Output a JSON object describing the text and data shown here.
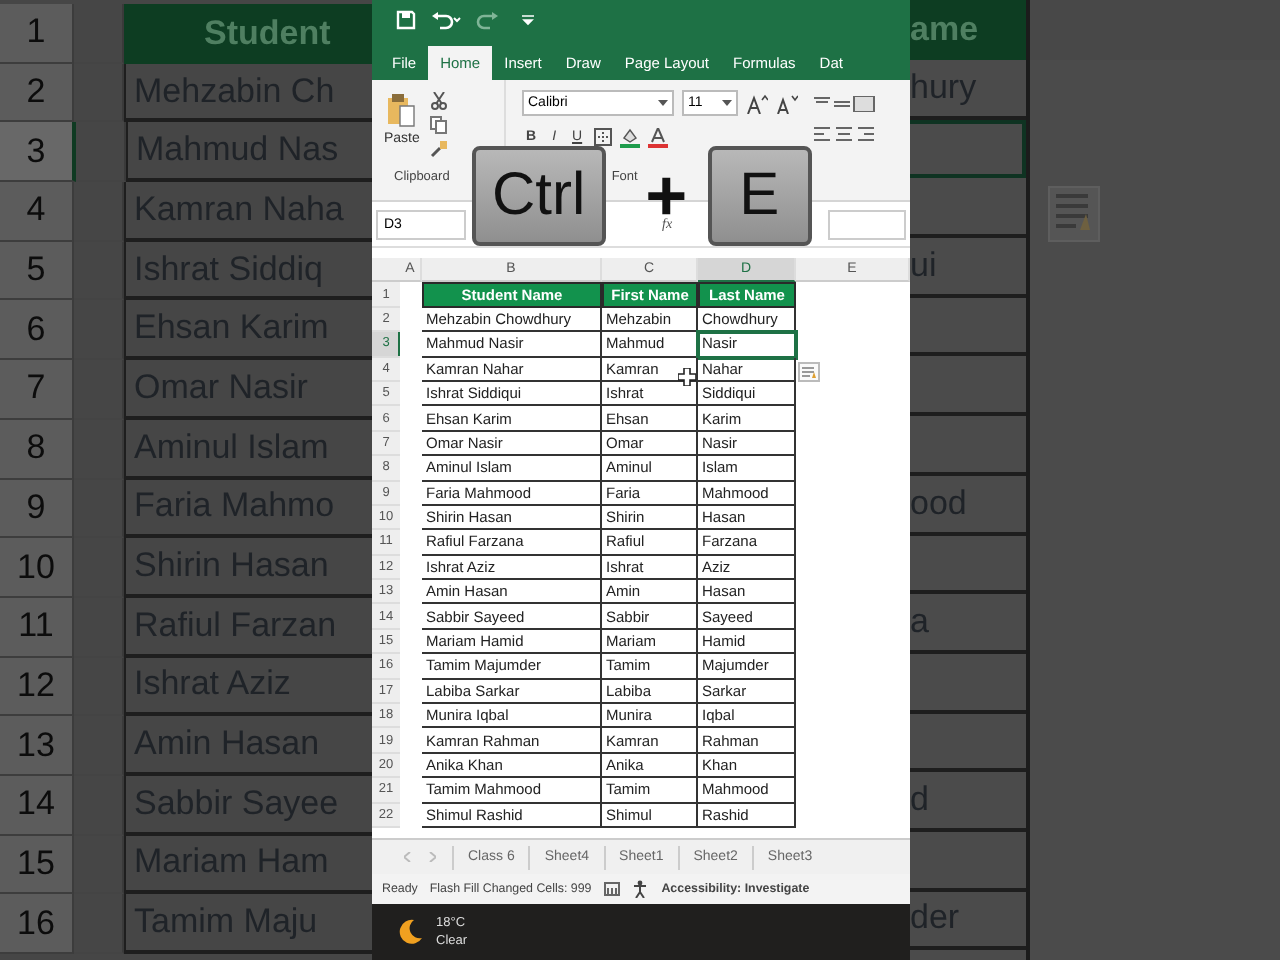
{
  "backdrop_left": {
    "header": {
      "number": "1",
      "text": "Student"
    },
    "rows": [
      {
        "number": "2",
        "text": "Mehzabin Ch",
        "selected": false
      },
      {
        "number": "3",
        "text": "Mahmud Nas",
        "selected": true
      },
      {
        "number": "4",
        "text": "Kamran Naha",
        "selected": false
      },
      {
        "number": "5",
        "text": "Ishrat Siddiq",
        "selected": false
      },
      {
        "number": "6",
        "text": "Ehsan Karim",
        "selected": false
      },
      {
        "number": "7",
        "text": "Omar Nasir",
        "selected": false
      },
      {
        "number": "8",
        "text": "Aminul Islam",
        "selected": false
      },
      {
        "number": "9",
        "text": "Faria Mahmo",
        "selected": false
      },
      {
        "number": "10",
        "text": "Shirin Hasan",
        "selected": false
      },
      {
        "number": "11",
        "text": "Rafiul Farzan",
        "selected": false
      },
      {
        "number": "12",
        "text": "Ishrat Aziz",
        "selected": false
      },
      {
        "number": "13",
        "text": "Amin Hasan",
        "selected": false
      },
      {
        "number": "14",
        "text": "Sabbir Sayee",
        "selected": false
      },
      {
        "number": "15",
        "text": "Mariam Ham",
        "selected": false
      },
      {
        "number": "16",
        "text": "Tamim Maju",
        "selected": false
      }
    ]
  },
  "ribbon_tabs": [
    {
      "label": "File",
      "selected": false
    },
    {
      "label": "Home",
      "selected": true
    },
    {
      "label": "Insert",
      "selected": false
    },
    {
      "label": "Draw",
      "selected": false
    },
    {
      "label": "Page Layout",
      "selected": false
    },
    {
      "label": "Formulas",
      "selected": false
    },
    {
      "label": "Dat",
      "selected": false
    }
  ],
  "ribbon": {
    "paste_label": "Paste",
    "font_name": "Calibri",
    "font_size": "11",
    "font_buttons": [
      "B",
      "I",
      "U"
    ],
    "groups": [
      "Clipboard",
      "Font"
    ]
  },
  "shortcut_overlay": {
    "keys": [
      "Ctrl",
      "E"
    ],
    "separator": "+"
  },
  "formula_bar": {
    "name_box": "D3",
    "function_label": "fx"
  },
  "columns": [
    {
      "label": "A",
      "selected": false
    },
    {
      "label": "B",
      "selected": false
    },
    {
      "label": "C",
      "selected": false
    },
    {
      "label": "D",
      "selected": true
    },
    {
      "label": "E",
      "selected": false
    }
  ],
  "table": {
    "header": {
      "number": "1",
      "cells": [
        "Student Name",
        "First Name",
        "Last Name"
      ]
    },
    "rows": [
      {
        "number": "2",
        "student": "Mehzabin Chowdhury",
        "first": "Mehzabin",
        "last": "Chowdhury",
        "selected": false
      },
      {
        "number": "3",
        "student": "Mahmud Nasir",
        "first": "Mahmud",
        "last": "Nasir",
        "selected": true
      },
      {
        "number": "4",
        "student": "Kamran Nahar",
        "first": "Kamran",
        "last": "Nahar",
        "selected": false
      },
      {
        "number": "5",
        "student": "Ishrat Siddiqui",
        "first": "Ishrat",
        "last": "Siddiqui",
        "selected": false
      },
      {
        "number": "6",
        "student": "Ehsan Karim",
        "first": "Ehsan",
        "last": "Karim",
        "selected": false
      },
      {
        "number": "7",
        "student": "Omar Nasir",
        "first": "Omar",
        "last": "Nasir",
        "selected": false
      },
      {
        "number": "8",
        "student": "Aminul Islam",
        "first": "Aminul",
        "last": "Islam",
        "selected": false
      },
      {
        "number": "9",
        "student": "Faria Mahmood",
        "first": "Faria",
        "last": "Mahmood",
        "selected": false
      },
      {
        "number": "10",
        "student": "Shirin Hasan",
        "first": "Shirin",
        "last": "Hasan",
        "selected": false
      },
      {
        "number": "11",
        "student": "Rafiul Farzana",
        "first": "Rafiul",
        "last": "Farzana",
        "selected": false
      },
      {
        "number": "12",
        "student": "Ishrat Aziz",
        "first": "Ishrat",
        "last": "Aziz",
        "selected": false
      },
      {
        "number": "13",
        "student": "Amin Hasan",
        "first": "Amin",
        "last": "Hasan",
        "selected": false
      },
      {
        "number": "14",
        "student": "Sabbir Sayeed",
        "first": "Sabbir",
        "last": "Sayeed",
        "selected": false
      },
      {
        "number": "15",
        "student": "Mariam Hamid",
        "first": "Mariam",
        "last": "Hamid",
        "selected": false
      },
      {
        "number": "16",
        "student": "Tamim Majumder",
        "first": "Tamim",
        "last": "Majumder",
        "selected": false
      },
      {
        "number": "17",
        "student": "Labiba Sarkar",
        "first": "Labiba",
        "last": "Sarkar",
        "selected": false
      },
      {
        "number": "18",
        "student": "Munira Iqbal",
        "first": "Munira",
        "last": "Iqbal",
        "selected": false
      },
      {
        "number": "19",
        "student": "Kamran Rahman",
        "first": "Kamran",
        "last": "Rahman",
        "selected": false
      },
      {
        "number": "20",
        "student": "Anika Khan",
        "first": "Anika",
        "last": "Khan",
        "selected": false
      },
      {
        "number": "21",
        "student": "Tamim Mahmood",
        "first": "Tamim",
        "last": "Mahmood",
        "selected": false
      },
      {
        "number": "22",
        "student": "Shimul Rashid",
        "first": "Shimul",
        "last": "Rashid",
        "selected": false
      }
    ]
  },
  "sheet_tabs": [
    {
      "label": "Class 6",
      "selected": false
    },
    {
      "label": "Sheet4",
      "selected": false
    },
    {
      "label": "Sheet1",
      "selected": false
    },
    {
      "label": "Sheet2",
      "selected": false
    },
    {
      "label": "Sheet3",
      "selected": false
    }
  ],
  "status_bar": {
    "mode": "Ready",
    "message": "Flash Fill Changed Cells: 999",
    "accessibility": "Accessibility: Investigate"
  },
  "taskbar": {
    "temperature": "18°C",
    "condition": "Clear"
  },
  "backdrop_right": {
    "header": "ame",
    "rows": [
      {
        "text": "hury",
        "selected": false
      },
      {
        "text": "",
        "selected": true
      },
      {
        "text": "",
        "selected": false
      },
      {
        "text": "ui",
        "selected": false
      },
      {
        "text": "",
        "selected": false
      },
      {
        "text": "",
        "selected": false
      },
      {
        "text": "",
        "selected": false
      },
      {
        "text": "ood",
        "selected": false
      },
      {
        "text": "",
        "selected": false
      },
      {
        "text": "a",
        "selected": false
      },
      {
        "text": "",
        "selected": false
      },
      {
        "text": "",
        "selected": false
      },
      {
        "text": "d",
        "selected": false
      },
      {
        "text": "",
        "selected": false
      },
      {
        "text": "der",
        "selected": false
      }
    ]
  }
}
